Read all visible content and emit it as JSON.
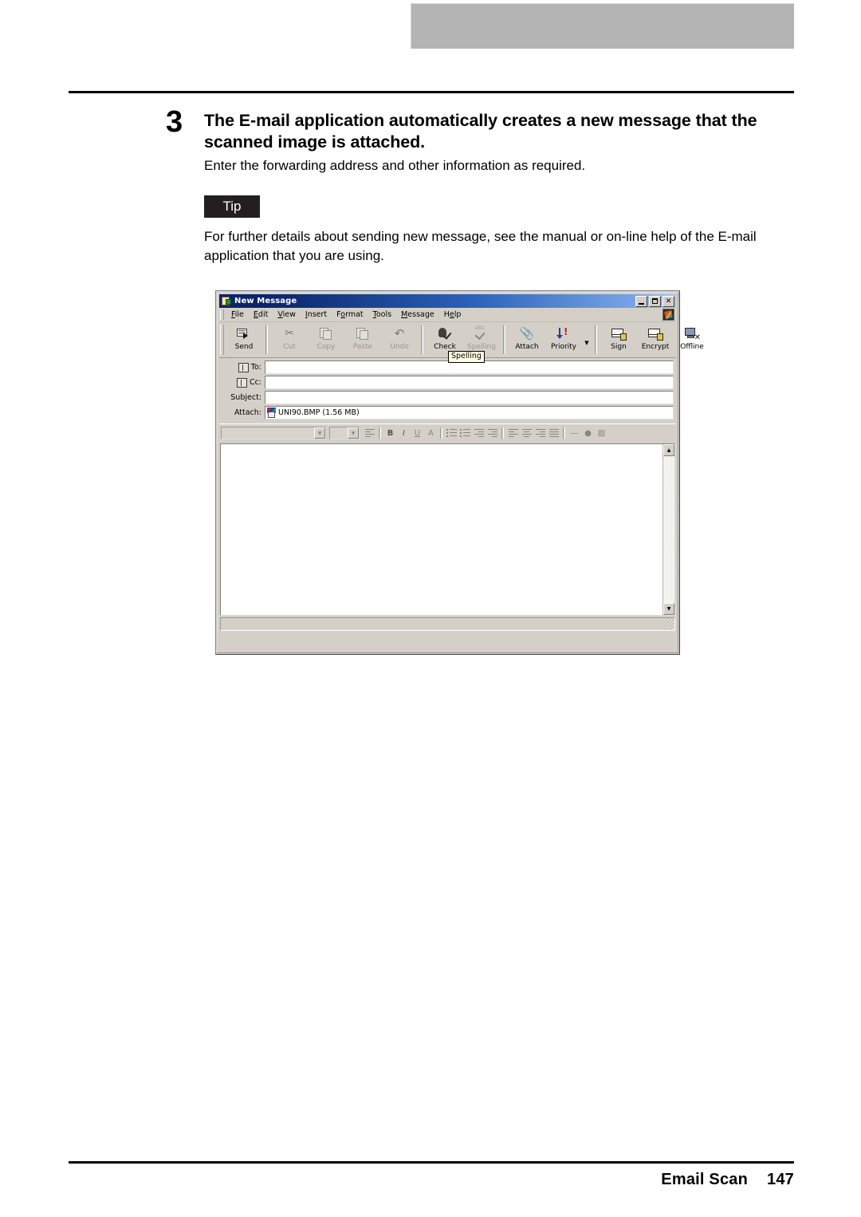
{
  "page": {
    "footer_label": "Email Scan",
    "page_number": "147"
  },
  "step": {
    "number": "3",
    "heading": "The E-mail application automatically creates a new message that the scanned image is attached.",
    "body": "Enter the forwarding address and other information as required."
  },
  "tip": {
    "badge": "Tip",
    "text": "For further details about sending new message, see the manual or on-line help of the E-mail application that you are using."
  },
  "window": {
    "title": "New Message",
    "window_buttons": {
      "minimize": "_",
      "maximize": "□",
      "close": "✕"
    },
    "menu": [
      {
        "pre": "",
        "key": "F",
        "post": "ile"
      },
      {
        "pre": "",
        "key": "E",
        "post": "dit"
      },
      {
        "pre": "",
        "key": "V",
        "post": "iew"
      },
      {
        "pre": "",
        "key": "I",
        "post": "nsert"
      },
      {
        "pre": "F",
        "key": "o",
        "post": "rmat"
      },
      {
        "pre": "",
        "key": "T",
        "post": "ools"
      },
      {
        "pre": "",
        "key": "M",
        "post": "essage"
      },
      {
        "pre": "H",
        "key": "e",
        "post": "lp"
      }
    ],
    "toolbar": [
      {
        "label": "Send",
        "icon": "send-icon",
        "disabled": false
      },
      {
        "label": "Cut",
        "icon": "scissors-icon",
        "disabled": true
      },
      {
        "label": "Copy",
        "icon": "copy-icon",
        "disabled": true
      },
      {
        "label": "Paste",
        "icon": "paste-icon",
        "disabled": true
      },
      {
        "label": "Undo",
        "icon": "undo-icon",
        "disabled": true
      },
      {
        "label": "Check",
        "icon": "check-names-icon",
        "disabled": false
      },
      {
        "label": "Spelling",
        "icon": "spelling-icon",
        "disabled": true
      },
      {
        "label": "Attach",
        "icon": "paperclip-icon",
        "disabled": false
      },
      {
        "label": "Priority",
        "icon": "priority-icon",
        "disabled": false
      },
      {
        "label": "Sign",
        "icon": "sign-envelope-icon",
        "disabled": false
      },
      {
        "label": "Encrypt",
        "icon": "encrypt-envelope-icon",
        "disabled": false
      },
      {
        "label": "Offline",
        "icon": "offline-monitor-icon",
        "disabled": false
      }
    ],
    "tooltip": "Spelling",
    "fields": [
      {
        "label": "To:",
        "value": "",
        "has_address_icon": true
      },
      {
        "label": "Cc:",
        "value": "",
        "has_address_icon": true
      },
      {
        "label": "Subject:",
        "value": "",
        "has_address_icon": false
      }
    ],
    "attach": {
      "label": "Attach:",
      "file": "UNI90.BMP (1.56 MB)"
    },
    "format_toolbar": {
      "font_family": "",
      "font_size": "",
      "buttons": [
        {
          "name": "paragraph-style-icon",
          "glyph": "≡"
        },
        {
          "name": "bold-icon",
          "glyph": "B"
        },
        {
          "name": "italic-icon",
          "glyph": "I"
        },
        {
          "name": "underline-icon",
          "glyph": "U"
        },
        {
          "name": "font-color-icon",
          "glyph": "A"
        },
        {
          "name": "numbered-list-icon",
          "glyph": ""
        },
        {
          "name": "bulleted-list-icon",
          "glyph": ""
        },
        {
          "name": "decrease-indent-icon",
          "glyph": ""
        },
        {
          "name": "increase-indent-icon",
          "glyph": ""
        },
        {
          "name": "align-left-icon",
          "glyph": ""
        },
        {
          "name": "align-center-icon",
          "glyph": ""
        },
        {
          "name": "align-right-icon",
          "glyph": ""
        },
        {
          "name": "justify-icon",
          "glyph": ""
        },
        {
          "name": "horizontal-rule-icon",
          "glyph": "—"
        },
        {
          "name": "insert-link-icon",
          "glyph": "●"
        },
        {
          "name": "insert-image-icon",
          "glyph": "▨"
        }
      ]
    },
    "body_text": ""
  },
  "colors": {
    "title_bar_start": "#0a246a",
    "title_bar_end": "#a6c8f0",
    "window_face": "#d4d0c8",
    "tip_badge": "#231f20",
    "top_bar_gray": "#b4b4b4",
    "tooltip_bg": "#ffffe1"
  }
}
